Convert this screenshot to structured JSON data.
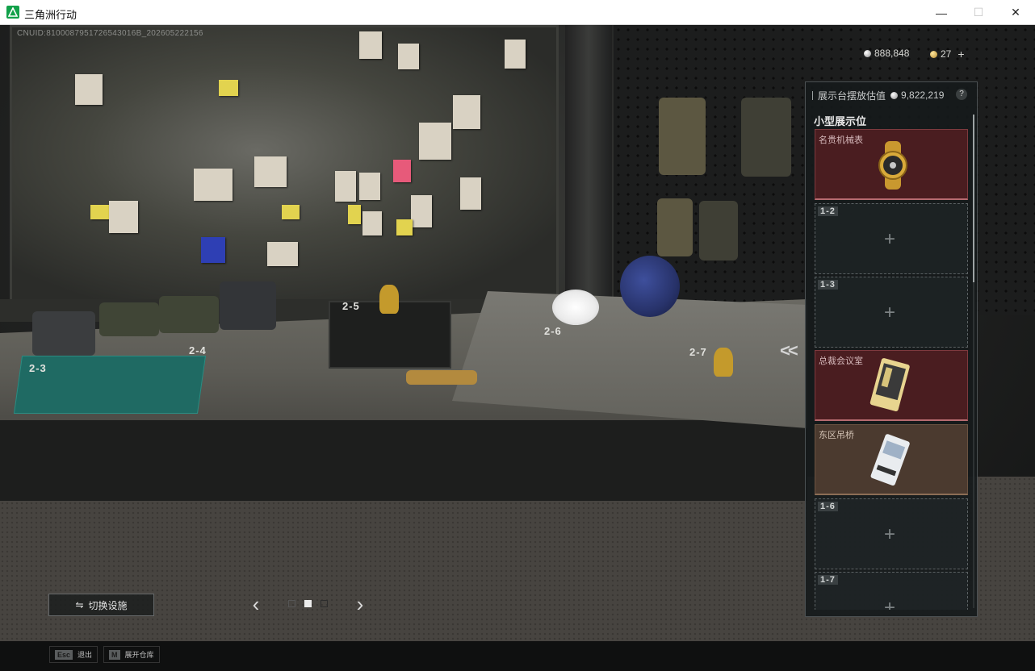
{
  "window": {
    "title": "三角洲行动",
    "minimize_icon": "minimize-icon",
    "maximize_icon": "maximize-icon",
    "close_icon": "close-icon"
  },
  "hud": {
    "cnuid": "CNUID:8100087951726543016B_202605222156",
    "currency_silver": "888,848",
    "currency_gold": "27",
    "add_symbol": "+"
  },
  "desk_labels": [
    "2-3",
    "2-4",
    "2-5",
    "2-6",
    "2-7"
  ],
  "panel": {
    "header_label": "展示台摆放估值",
    "header_value": "9,822,219",
    "help": "?",
    "section_title": "小型展示位",
    "slots": [
      {
        "code": "",
        "name": "名贵机械表",
        "state": "filled"
      },
      {
        "code": "1-2",
        "name": "",
        "state": "empty"
      },
      {
        "code": "1-3",
        "name": "",
        "state": "empty"
      },
      {
        "code": "",
        "name": "总裁会议室",
        "state": "filled"
      },
      {
        "code": "",
        "name": "东区吊桥",
        "state": "filled"
      },
      {
        "code": "1-6",
        "name": "",
        "state": "empty"
      },
      {
        "code": "1-7",
        "name": "",
        "state": "empty"
      }
    ]
  },
  "controls": {
    "switch_label": "切换设施",
    "prev_icon": "chevron-left-icon",
    "next_icon": "chevron-right-icon",
    "collapse_icon": "double-chevron-left-icon",
    "page_active": 2,
    "page_count": 3
  },
  "hints": [
    {
      "key": "Esc",
      "label": "退出"
    },
    {
      "key": "M",
      "label": "展开仓库"
    }
  ],
  "colors": {
    "slot_rare_red": "#4a1d20",
    "slot_brown": "#4b3a2f",
    "mat_green": "#1f6a63",
    "app_icon_green": "#12a14a"
  }
}
